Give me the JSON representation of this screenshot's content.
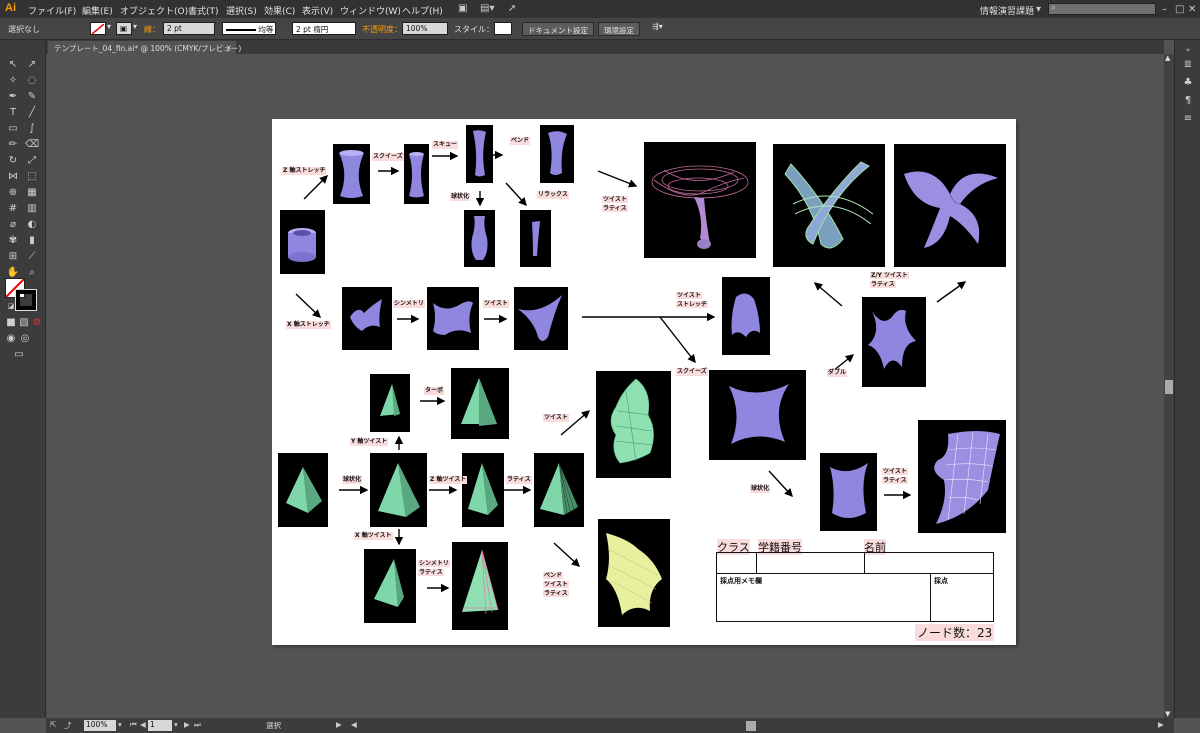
{
  "app": {
    "logo": "Ai",
    "menu": [
      "ファイル(F)",
      "編集(E)",
      "オブジェクト(O)",
      "書式(T)",
      "選択(S)",
      "効果(C)",
      "表示(V)",
      "ウィンドウ(W)",
      "ヘルプ(H)"
    ],
    "workspace": "情報演習課題",
    "search_placeholder": ""
  },
  "control_bar": {
    "selection": "選択なし",
    "stroke_label": "線：",
    "stroke_weight": "2 pt",
    "profile": "均等",
    "brush": "2 pt 楕円",
    "opacity_label": "不透明度：",
    "opacity_value": "100%",
    "style_label": "スタイル：",
    "doc_settings": "ドキュメント設定",
    "preferences": "環境設定"
  },
  "document": {
    "tab_title": "テンプレート_04_fin.ai* @ 100% (CMYK/プレビュー)"
  },
  "status": {
    "zoom": "100%",
    "page": "1",
    "tool": "選択"
  },
  "artboard": {
    "labels": {
      "z_stretch": "Z 軸ストレッチ",
      "squeeze1": "スクイーズ",
      "skew": "スキュー",
      "bend1": "ベンド",
      "spherize1": "球状化",
      "relax": "リラックス",
      "twist_lattice_line1": "ツイスト",
      "twist_lattice_line2": "ラティス",
      "x_stretch": "X 軸ストレッチ",
      "symmetry1": "シンメトリ",
      "twist1": "ツイスト",
      "twist_stretch_line1": "ツイスト",
      "twist_stretch_line2": "ストレッチ",
      "zy_twist_line1": "Z/Y ツイスト",
      "zy_twist_line2": "ラティス",
      "squeeze2": "スクイーズ",
      "double": "ダブル",
      "turbo": "ターボ",
      "y_twist": "Y 軸ツイスト",
      "twist2": "ツイスト",
      "spherize2": "球状化",
      "z_twist": "Z 軸ツイスト",
      "lattice": "ラティス",
      "spherize3": "球状化",
      "twist_lattice2_line1": "ツイスト",
      "twist_lattice2_line2": "ラティス",
      "x_twist": "X 軸ツイスト",
      "sym_lattice_line1": "シンメトリ",
      "sym_lattice_line2": "ラティス",
      "bend_twist_line1": "ベンド",
      "bend_twist_line2": "ツイスト",
      "bend_twist_line3": "ラティス"
    },
    "form": {
      "class_label": "クラス",
      "id_label": "学籍番号",
      "name_label": "名前",
      "memo_label": "採点用メモ欄",
      "score_label": "採点",
      "node_count": "ノード数：23"
    }
  },
  "colors": {
    "shape_purple": "#8f86e0",
    "shape_green": "#7fd6a8",
    "shape_yellow": "#e8f0a0",
    "label_bg": "#fbdcdc",
    "logo": "#ff9a00"
  }
}
